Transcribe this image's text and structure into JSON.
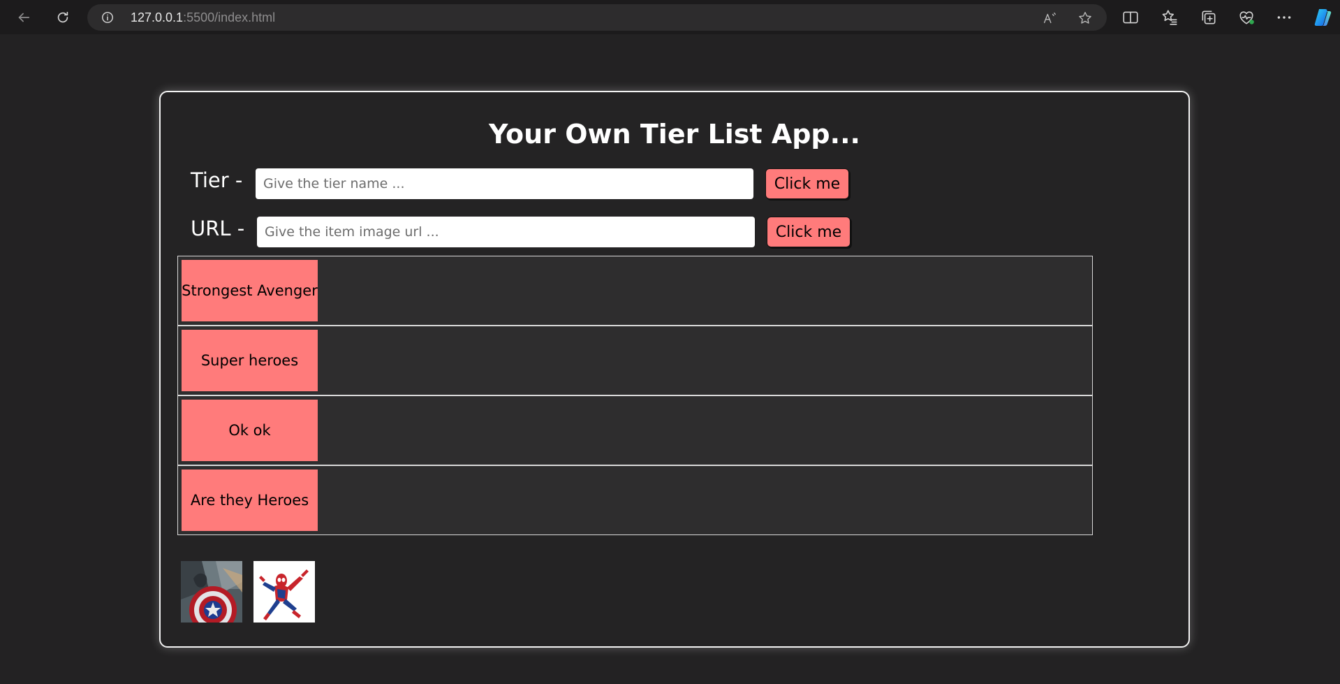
{
  "browser": {
    "url_host": "127.0.0.1",
    "url_rest": ":5500/index.html"
  },
  "app": {
    "title": "Your Own Tier List App...",
    "tier_form": {
      "label": "Tier -",
      "placeholder": "Give the tier name ...",
      "button_label": "Click me"
    },
    "url_form": {
      "label": "URL -",
      "placeholder": "Give the item image url ...",
      "button_label": "Click me"
    },
    "tiers": [
      {
        "label": "Strongest Avenger"
      },
      {
        "label": "Super heroes"
      },
      {
        "label": "Ok ok"
      },
      {
        "label": "Are they Heroes"
      }
    ],
    "pool_items": [
      {
        "icon": "captain-america-shield-image"
      },
      {
        "icon": "spider-man-image"
      }
    ],
    "colors": {
      "accent": "#ff7b7b",
      "page_bg": "#232223",
      "tier_bg": "#2e2d2e"
    }
  }
}
